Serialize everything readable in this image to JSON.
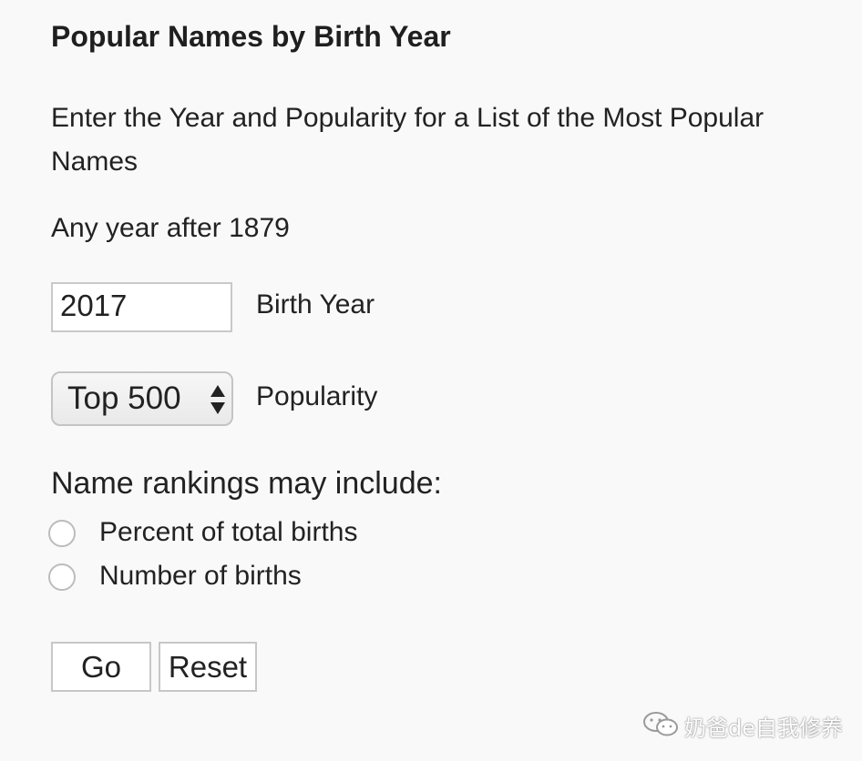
{
  "heading": "Popular Names by Birth Year",
  "intro": "Enter the Year and Popularity for a List of the Most Popular Names",
  "year_hint": "Any year after 1879",
  "birth_year": {
    "value": "2017",
    "label": "Birth Year"
  },
  "popularity": {
    "selected": "Top 500",
    "label": "Popularity"
  },
  "rankings": {
    "heading": "Name rankings may include:",
    "options": [
      {
        "label": "Percent of total births",
        "checked": false
      },
      {
        "label": "Number of births",
        "checked": false
      }
    ]
  },
  "buttons": {
    "go": "Go",
    "reset": "Reset"
  },
  "watermark": {
    "text": "奶爸de自我修养"
  },
  "colors": {
    "background": "#f9f9f9",
    "text": "#222222",
    "border": "#c9c9c9"
  }
}
